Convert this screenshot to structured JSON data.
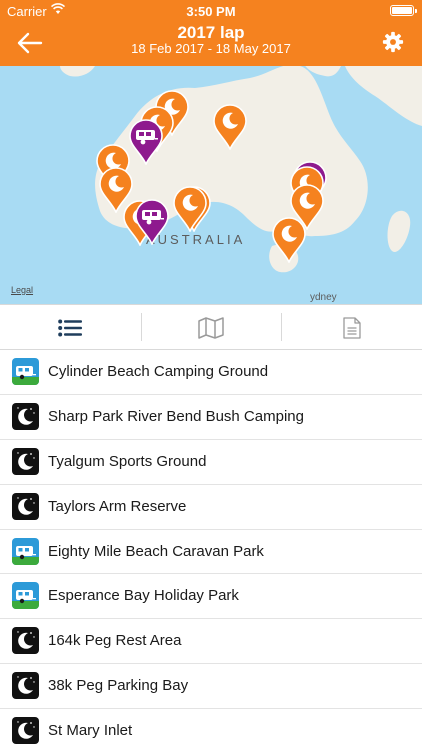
{
  "status_bar": {
    "carrier": "Carrier",
    "time": "3:50 PM"
  },
  "nav": {
    "title": "2017 lap",
    "subtitle": "18 Feb 2017 - 18 May 2017"
  },
  "map": {
    "country_label": "AUSTRALIA",
    "city_label": "ydney",
    "legal": "Legal"
  },
  "tabs": [
    {
      "name": "list",
      "icon": "list-icon",
      "selected": true
    },
    {
      "name": "map",
      "icon": "map-icon",
      "selected": false
    },
    {
      "name": "notes",
      "icon": "document-icon",
      "selected": false
    }
  ],
  "sites": [
    {
      "label": "Cylinder Beach Camping Ground",
      "type": "caravan"
    },
    {
      "label": "Sharp Park River Bend Bush Camping",
      "type": "night"
    },
    {
      "label": "Tyalgum Sports Ground",
      "type": "night"
    },
    {
      "label": "Taylors Arm Reserve",
      "type": "night"
    },
    {
      "label": "Eighty Mile Beach Caravan Park",
      "type": "caravan"
    },
    {
      "label": "Esperance Bay Holiday Park",
      "type": "caravan"
    },
    {
      "label": "164k Peg Rest Area",
      "type": "night"
    },
    {
      "label": "38k Peg Parking Bay",
      "type": "night"
    },
    {
      "label": "St Mary Inlet",
      "type": "night"
    }
  ],
  "colors": {
    "accent": "#f5821f",
    "caravan_pin": "#8e1a8e",
    "map_water": "#a8dbf3",
    "map_land": "#f2efe7"
  }
}
